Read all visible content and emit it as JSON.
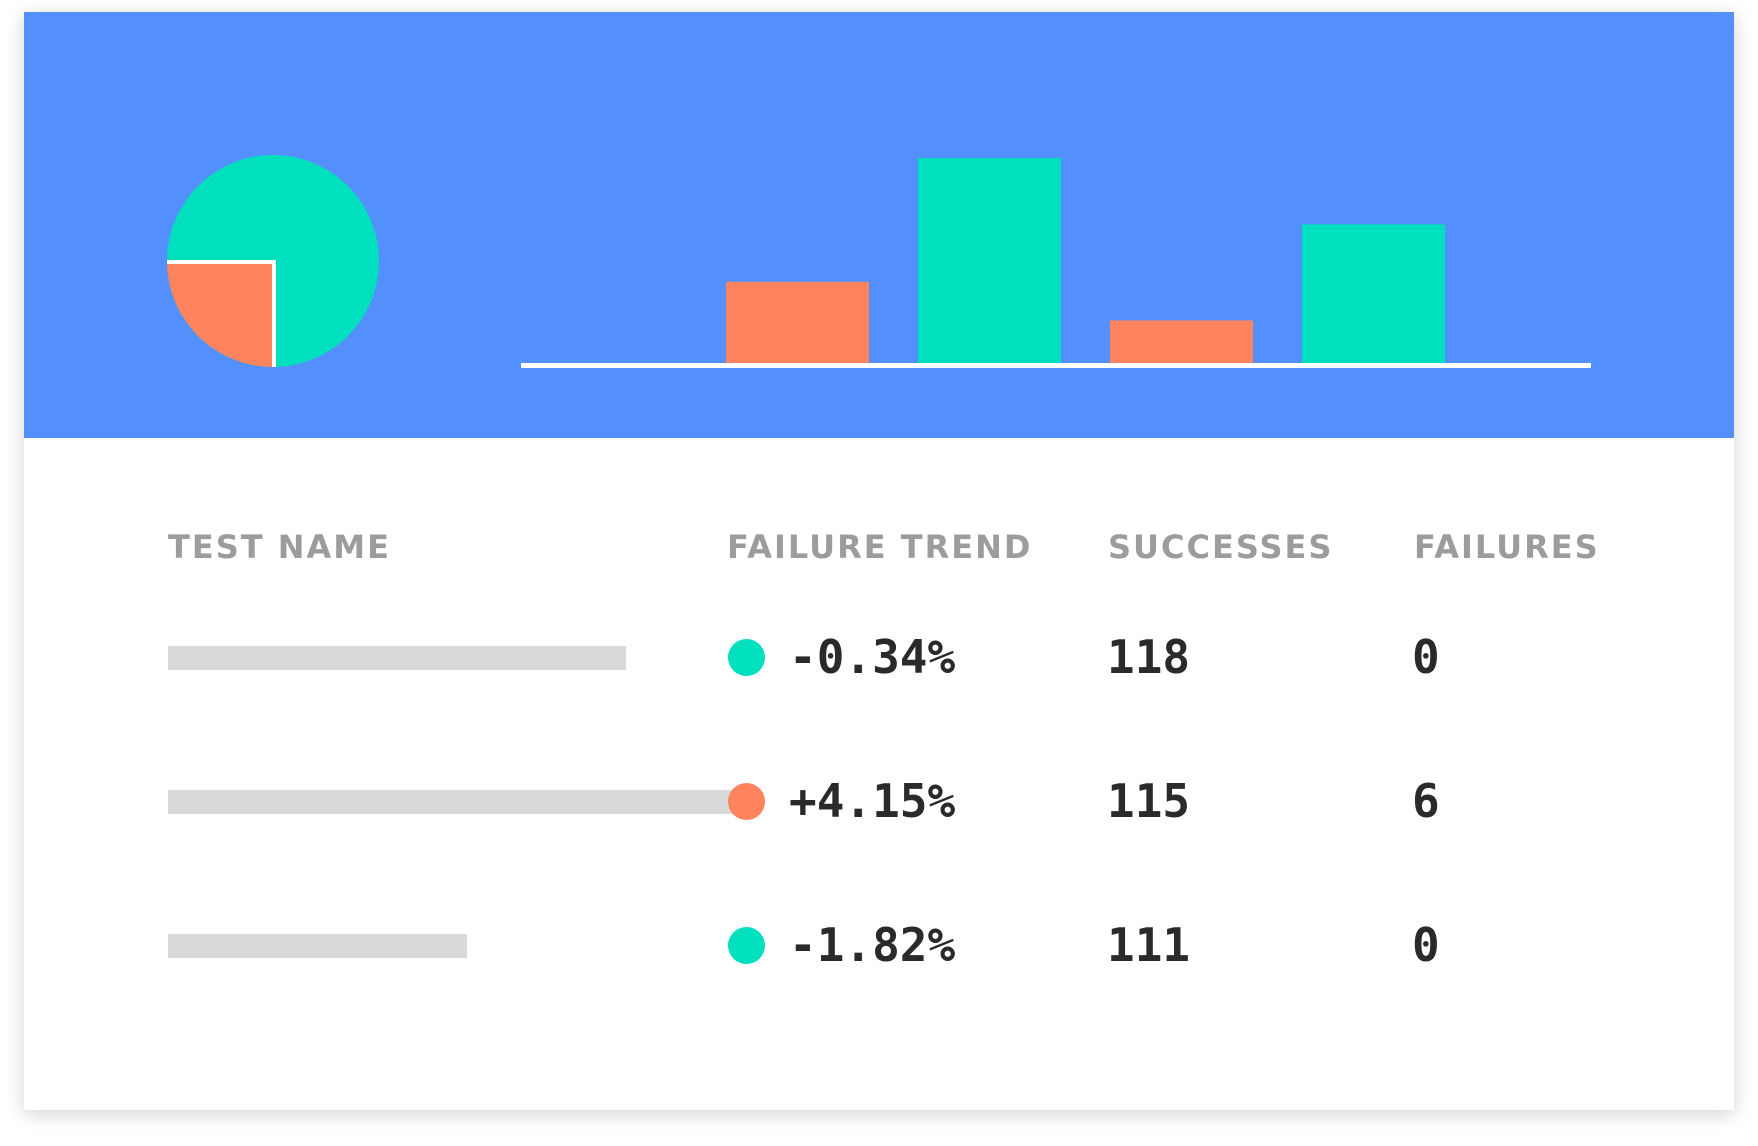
{
  "colors": {
    "banner": "#548ffe",
    "success": "#00dfbe",
    "failure": "#ff845e",
    "axis": "#ffffff",
    "placeholder": "#d9d9d9",
    "header_text": "#9c9c9c",
    "value_text": "#2a2a2a"
  },
  "chart_data": [
    {
      "type": "pie",
      "slices": [
        {
          "label": "",
          "value": 75,
          "color": "#00dfbe"
        },
        {
          "label": "",
          "value": 25,
          "color": "#ff845e"
        }
      ]
    },
    {
      "type": "bar",
      "categories": [
        "",
        "",
        "",
        ""
      ],
      "values": [
        83,
        208,
        44,
        141
      ],
      "colors": [
        "#ff845e",
        "#00dfbe",
        "#ff845e",
        "#00dfbe"
      ],
      "ylim": [
        0,
        208
      ]
    }
  ],
  "table": {
    "columns": [
      "TEST NAME",
      "FAILURE TREND",
      "SUCCESSES",
      "FAILURES"
    ],
    "rows": [
      {
        "name_redacted_fraction": 0.367,
        "trend": "-0.34%",
        "trend_status": "success",
        "successes": "118",
        "failures": "0"
      },
      {
        "name_redacted_fraction": 0.457,
        "trend": "+4.15%",
        "trend_status": "failure",
        "successes": "115",
        "failures": "6"
      },
      {
        "name_redacted_fraction": 0.24,
        "trend": "-1.82%",
        "trend_status": "success",
        "successes": "111",
        "failures": "0"
      }
    ]
  }
}
